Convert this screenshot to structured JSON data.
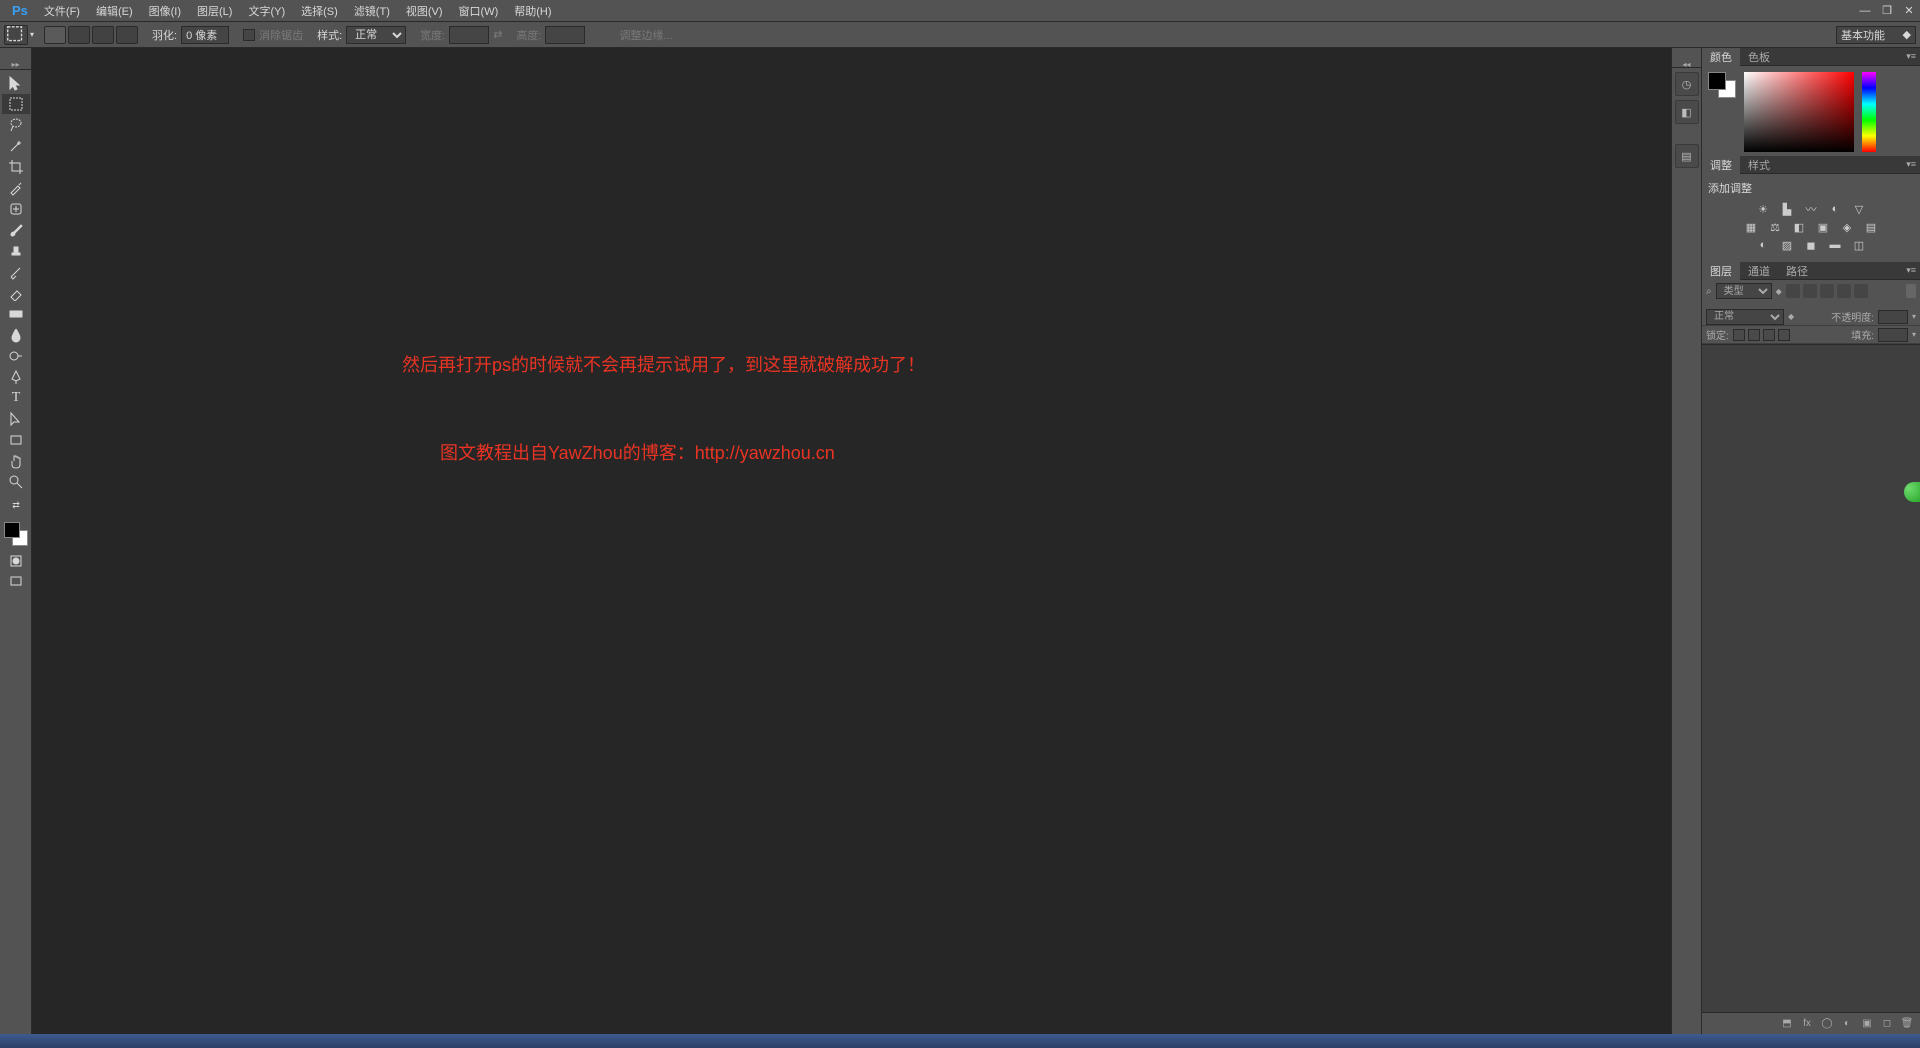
{
  "app": {
    "logo": "Ps"
  },
  "menu": {
    "file": "文件(F)",
    "edit": "编辑(E)",
    "image": "图像(I)",
    "layer": "图层(L)",
    "type": "文字(Y)",
    "select": "选择(S)",
    "filter": "滤镜(T)",
    "view": "视图(V)",
    "window": "窗口(W)",
    "help": "帮助(H)"
  },
  "options": {
    "feather_label": "羽化:",
    "feather_value": "0 像素",
    "antialias": "消除锯齿",
    "style_label": "样式:",
    "style_value": "正常",
    "width_label": "宽度:",
    "height_label": "高度:",
    "refine_edge": "调整边缘...",
    "workspace": "基本功能"
  },
  "panels": {
    "color_tab": "颜色",
    "swatches_tab": "色板",
    "adjust_tab": "调整",
    "styles_tab": "样式",
    "adjust_title": "添加调整",
    "layers_tab": "图层",
    "channels_tab": "通道",
    "paths_tab": "路径",
    "kind_label": "类型",
    "blend_mode": "正常",
    "opacity_label": "不透明度:",
    "lock_label": "锁定:",
    "fill_label": "填充:"
  },
  "overlay": {
    "line1": "然后再打开ps的时候就不会再提示试用了，到这里就破解成功了！",
    "line2": "图文教程出自YawZhou的博客：http://yawzhou.cn"
  }
}
